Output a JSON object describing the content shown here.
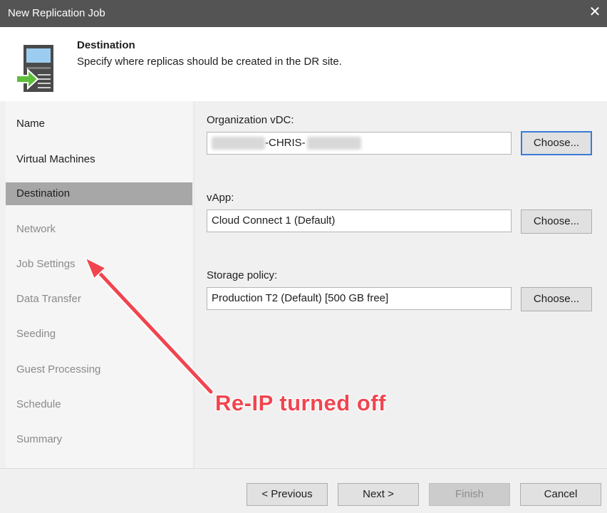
{
  "window": {
    "title": "New Replication Job",
    "close_glyph": "✕"
  },
  "header": {
    "title": "Destination",
    "subtitle": "Specify where replicas should be created in the DR site.",
    "icon": "server-arrow-icon"
  },
  "nav": {
    "items": [
      {
        "label": "Name",
        "state": "done"
      },
      {
        "label": "Virtual Machines",
        "state": "done"
      },
      {
        "label": "Destination",
        "state": "active"
      },
      {
        "label": "Network",
        "state": "pending"
      },
      {
        "label": "Job Settings",
        "state": "pending"
      },
      {
        "label": "Data Transfer",
        "state": "pending"
      },
      {
        "label": "Seeding",
        "state": "pending"
      },
      {
        "label": "Guest Processing",
        "state": "pending"
      },
      {
        "label": "Schedule",
        "state": "pending"
      },
      {
        "label": "Summary",
        "state": "pending"
      }
    ]
  },
  "form": {
    "org_vdc": {
      "label": "Organization vDC:",
      "value": "-CHRIS-",
      "button": "Choose..."
    },
    "vapp": {
      "label": "vApp:",
      "value": "Cloud Connect 1 (Default)",
      "button": "Choose..."
    },
    "storage_policy": {
      "label": "Storage policy:",
      "value": "Production T2 (Default) [500 GB free]",
      "button": "Choose..."
    }
  },
  "footer": {
    "previous": "< Previous",
    "next": "Next >",
    "finish": "Finish",
    "cancel": "Cancel"
  },
  "annotation": {
    "text": "Re-IP turned off",
    "color": "#f0454f"
  }
}
